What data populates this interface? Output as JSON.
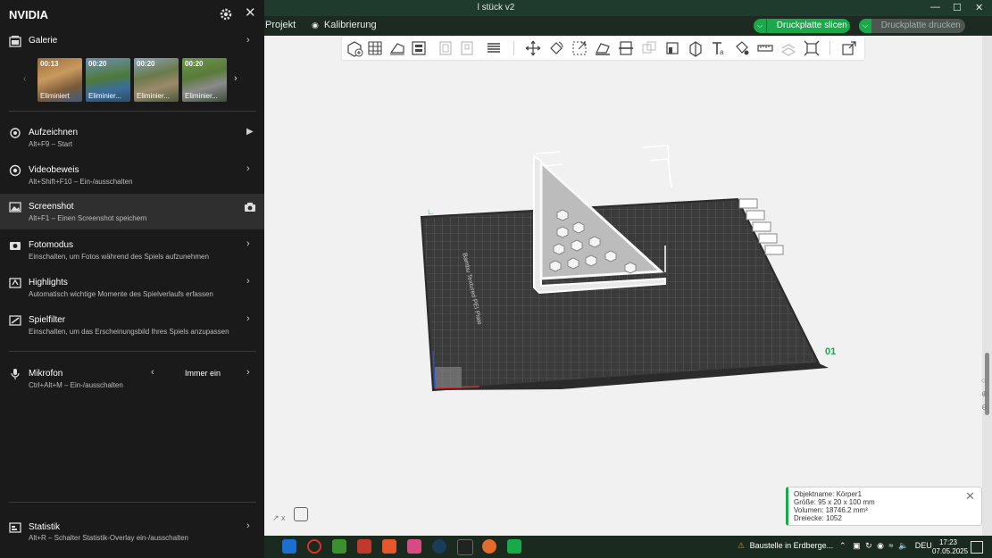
{
  "window": {
    "title": "l stück v2"
  },
  "menubar": {
    "project": "Projekt",
    "calibration": "Kalibrierung",
    "slice_plate": "Druckplatte slicen",
    "print_plate": "Druckplatte drucken"
  },
  "plate": {
    "label": "Bambu Textured PEI Plate",
    "number": "01"
  },
  "object_info": {
    "name": "Objektname: Körper1",
    "size": "Größe: 95 x 20 x 100 mm",
    "volume": "Volumen: 18746.2 mm³",
    "triangles": "Dreiecke: 1052"
  },
  "nvidia": {
    "title": "NVIDIA",
    "gallery": {
      "label": "Galerie",
      "thumbs": [
        {
          "time": "00:13",
          "caption": "Eliminiert"
        },
        {
          "time": "00:20",
          "caption": "Eliminier..."
        },
        {
          "time": "00:20",
          "caption": "Eliminier..."
        },
        {
          "time": "00:20",
          "caption": "Eliminier..."
        }
      ]
    },
    "items": [
      {
        "label": "Aufzeichnen",
        "sub": "Alt+F9 – Start"
      },
      {
        "label": "Videobeweis",
        "sub": "Alt+Shift+F10 – Ein-/ausschalten"
      },
      {
        "label": "Screenshot",
        "sub": "Alt+F1 – Einen Screenshot speichern"
      },
      {
        "label": "Fotomodus",
        "sub": "Einschalten, um Fotos während des Spiels aufzunehmen"
      },
      {
        "label": "Highlights",
        "sub": "Automatisch wichtige Momente des Spielverlaufs erfassen"
      },
      {
        "label": "Spielfilter",
        "sub": "Einschalten, um das Erscheinungsbild Ihres Spiels anzupassen"
      }
    ],
    "mic": {
      "label": "Mikrofon",
      "sub": "Ctrl+Alt+M – Ein-/ausschalten",
      "value": "Immer ein"
    },
    "stats": {
      "label": "Statistik",
      "sub": "Alt+R – Schalter Statistik-Overlay ein-/ausschalten"
    }
  },
  "taskbar": {
    "weather": "Baustelle in Erdberge...",
    "language": "DEU",
    "time": "17:23",
    "date": "07.05.2025"
  },
  "colors": {
    "accent_green": "#19a84a",
    "nvidia_bg": "#1a1a1a",
    "titlebar": "#1e3b2d"
  }
}
